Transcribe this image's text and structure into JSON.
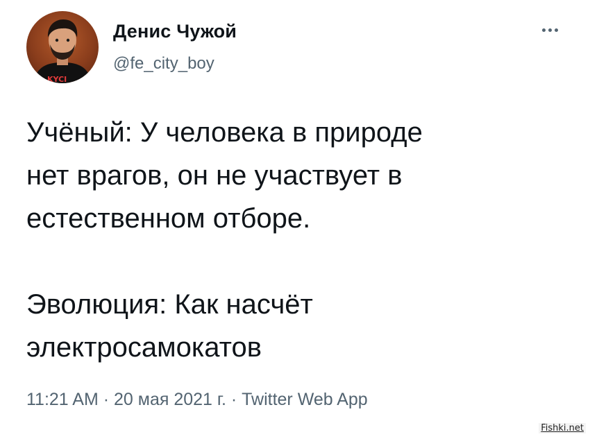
{
  "author": {
    "name": "Денис Чужой",
    "handle": "@fe_city_boy",
    "avatar_shirt_text": "KYCI"
  },
  "more_icon": "more-horizontal-icon",
  "tweet": {
    "paragraph_1": "Учёный: У человека в природе\nнет врагов, он не участвует в\nестественном отборе.",
    "paragraph_2": "Эволюция: Как насчёт\nэлектросамокатов"
  },
  "meta": {
    "time": "11:21 AM",
    "separator": " · ",
    "date": "20 мая 2021 г.",
    "source": "Twitter Web App"
  },
  "watermark": "Fishki.net",
  "colors": {
    "text": "#0f1419",
    "secondary": "#536471",
    "background": "#ffffff"
  }
}
